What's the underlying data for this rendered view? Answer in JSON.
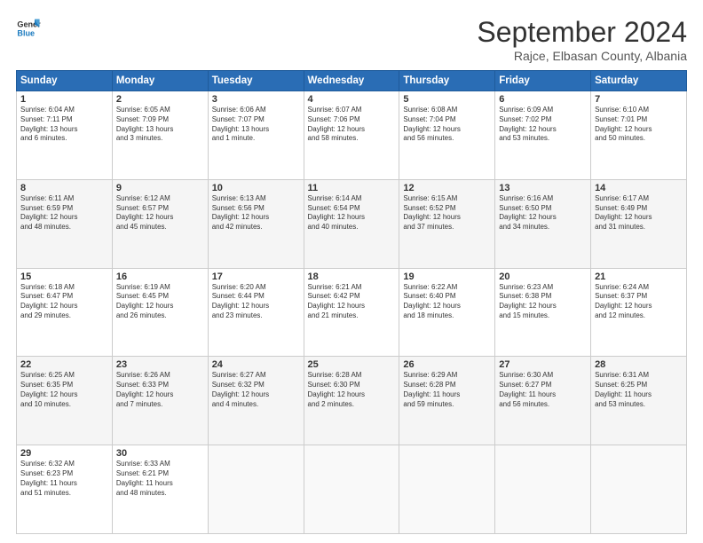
{
  "header": {
    "logo_line1": "General",
    "logo_line2": "Blue",
    "month_title": "September 2024",
    "subtitle": "Rajce, Elbasan County, Albania"
  },
  "days_of_week": [
    "Sunday",
    "Monday",
    "Tuesday",
    "Wednesday",
    "Thursday",
    "Friday",
    "Saturday"
  ],
  "weeks": [
    [
      {
        "num": "1",
        "info": "Sunrise: 6:04 AM\nSunset: 7:11 PM\nDaylight: 13 hours\nand 6 minutes."
      },
      {
        "num": "2",
        "info": "Sunrise: 6:05 AM\nSunset: 7:09 PM\nDaylight: 13 hours\nand 3 minutes."
      },
      {
        "num": "3",
        "info": "Sunrise: 6:06 AM\nSunset: 7:07 PM\nDaylight: 13 hours\nand 1 minute."
      },
      {
        "num": "4",
        "info": "Sunrise: 6:07 AM\nSunset: 7:06 PM\nDaylight: 12 hours\nand 58 minutes."
      },
      {
        "num": "5",
        "info": "Sunrise: 6:08 AM\nSunset: 7:04 PM\nDaylight: 12 hours\nand 56 minutes."
      },
      {
        "num": "6",
        "info": "Sunrise: 6:09 AM\nSunset: 7:02 PM\nDaylight: 12 hours\nand 53 minutes."
      },
      {
        "num": "7",
        "info": "Sunrise: 6:10 AM\nSunset: 7:01 PM\nDaylight: 12 hours\nand 50 minutes."
      }
    ],
    [
      {
        "num": "8",
        "info": "Sunrise: 6:11 AM\nSunset: 6:59 PM\nDaylight: 12 hours\nand 48 minutes."
      },
      {
        "num": "9",
        "info": "Sunrise: 6:12 AM\nSunset: 6:57 PM\nDaylight: 12 hours\nand 45 minutes."
      },
      {
        "num": "10",
        "info": "Sunrise: 6:13 AM\nSunset: 6:56 PM\nDaylight: 12 hours\nand 42 minutes."
      },
      {
        "num": "11",
        "info": "Sunrise: 6:14 AM\nSunset: 6:54 PM\nDaylight: 12 hours\nand 40 minutes."
      },
      {
        "num": "12",
        "info": "Sunrise: 6:15 AM\nSunset: 6:52 PM\nDaylight: 12 hours\nand 37 minutes."
      },
      {
        "num": "13",
        "info": "Sunrise: 6:16 AM\nSunset: 6:50 PM\nDaylight: 12 hours\nand 34 minutes."
      },
      {
        "num": "14",
        "info": "Sunrise: 6:17 AM\nSunset: 6:49 PM\nDaylight: 12 hours\nand 31 minutes."
      }
    ],
    [
      {
        "num": "15",
        "info": "Sunrise: 6:18 AM\nSunset: 6:47 PM\nDaylight: 12 hours\nand 29 minutes."
      },
      {
        "num": "16",
        "info": "Sunrise: 6:19 AM\nSunset: 6:45 PM\nDaylight: 12 hours\nand 26 minutes."
      },
      {
        "num": "17",
        "info": "Sunrise: 6:20 AM\nSunset: 6:44 PM\nDaylight: 12 hours\nand 23 minutes."
      },
      {
        "num": "18",
        "info": "Sunrise: 6:21 AM\nSunset: 6:42 PM\nDaylight: 12 hours\nand 21 minutes."
      },
      {
        "num": "19",
        "info": "Sunrise: 6:22 AM\nSunset: 6:40 PM\nDaylight: 12 hours\nand 18 minutes."
      },
      {
        "num": "20",
        "info": "Sunrise: 6:23 AM\nSunset: 6:38 PM\nDaylight: 12 hours\nand 15 minutes."
      },
      {
        "num": "21",
        "info": "Sunrise: 6:24 AM\nSunset: 6:37 PM\nDaylight: 12 hours\nand 12 minutes."
      }
    ],
    [
      {
        "num": "22",
        "info": "Sunrise: 6:25 AM\nSunset: 6:35 PM\nDaylight: 12 hours\nand 10 minutes."
      },
      {
        "num": "23",
        "info": "Sunrise: 6:26 AM\nSunset: 6:33 PM\nDaylight: 12 hours\nand 7 minutes."
      },
      {
        "num": "24",
        "info": "Sunrise: 6:27 AM\nSunset: 6:32 PM\nDaylight: 12 hours\nand 4 minutes."
      },
      {
        "num": "25",
        "info": "Sunrise: 6:28 AM\nSunset: 6:30 PM\nDaylight: 12 hours\nand 2 minutes."
      },
      {
        "num": "26",
        "info": "Sunrise: 6:29 AM\nSunset: 6:28 PM\nDaylight: 11 hours\nand 59 minutes."
      },
      {
        "num": "27",
        "info": "Sunrise: 6:30 AM\nSunset: 6:27 PM\nDaylight: 11 hours\nand 56 minutes."
      },
      {
        "num": "28",
        "info": "Sunrise: 6:31 AM\nSunset: 6:25 PM\nDaylight: 11 hours\nand 53 minutes."
      }
    ],
    [
      {
        "num": "29",
        "info": "Sunrise: 6:32 AM\nSunset: 6:23 PM\nDaylight: 11 hours\nand 51 minutes."
      },
      {
        "num": "30",
        "info": "Sunrise: 6:33 AM\nSunset: 6:21 PM\nDaylight: 11 hours\nand 48 minutes."
      },
      {
        "num": "",
        "info": ""
      },
      {
        "num": "",
        "info": ""
      },
      {
        "num": "",
        "info": ""
      },
      {
        "num": "",
        "info": ""
      },
      {
        "num": "",
        "info": ""
      }
    ]
  ]
}
